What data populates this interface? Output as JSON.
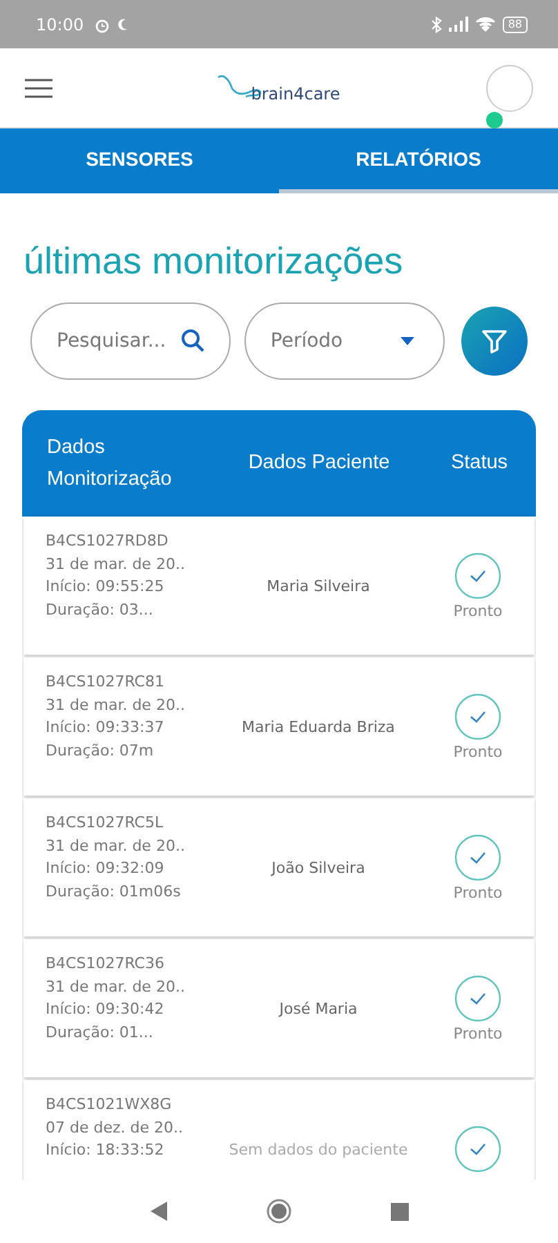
{
  "status_bar": {
    "time": "10:00",
    "battery": "88"
  },
  "app_bar": {
    "logo": "brain4care"
  },
  "tabs": [
    {
      "label": "SENSORES",
      "selected": false
    },
    {
      "label": "RELATÓRIOS",
      "selected": true
    }
  ],
  "title": "últimas monitorizações",
  "search": {
    "placeholder": "Pesquisar..."
  },
  "period": {
    "placeholder": "Período"
  },
  "table": {
    "columns": [
      "Dados Monitorização",
      "Dados Paciente",
      "Status"
    ],
    "rows": [
      {
        "lines": [
          "B4CS1027RD8D",
          "31 de mar. de 20..",
          "Início: 09:55:25",
          "Duração: 03..."
        ],
        "patient": "Maria Silveira",
        "patient_missing": false,
        "status": "Pronto"
      },
      {
        "lines": [
          "B4CS1027RC81",
          "31 de mar. de 20..",
          "Início: 09:33:37",
          "Duração: 07m"
        ],
        "patient": "Maria Eduarda Briza",
        "patient_missing": false,
        "status": "Pronto"
      },
      {
        "lines": [
          "B4CS1027RC5L",
          "31 de mar. de 20..",
          "Início: 09:32:09",
          "Duração: 01m06s"
        ],
        "patient": "João Silveira",
        "patient_missing": false,
        "status": "Pronto"
      },
      {
        "lines": [
          "B4CS1027RC36",
          "31 de mar. de 20..",
          "Início: 09:30:42",
          "Duração: 01..."
        ],
        "patient": "José Maria",
        "patient_missing": false,
        "status": "Pronto"
      },
      {
        "lines": [
          "B4CS1021WX8G",
          "07 de dez. de 20..",
          "Início: 18:33:52"
        ],
        "patient": "Sem dados do paciente",
        "patient_missing": true
      }
    ]
  }
}
